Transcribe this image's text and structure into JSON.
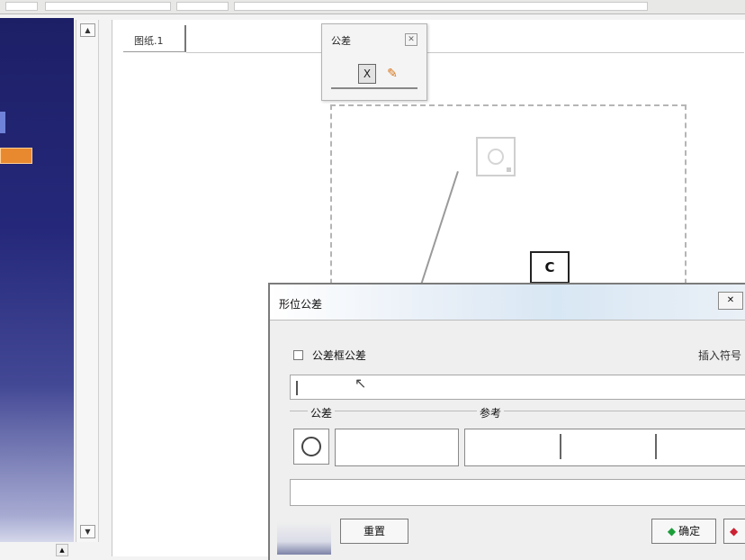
{
  "document": {
    "tab_label": "图纸.1"
  },
  "palette": {
    "title": "公差",
    "close_glyph": "✕",
    "tool1_glyph": "X",
    "tool2_glyph": "✎"
  },
  "marker": {
    "label": "C"
  },
  "dialog": {
    "title": "形位公差",
    "close_glyph": "✕",
    "checkbox_label": "公差框公差",
    "right_text": "插入符号",
    "group_tolerance_label": "公差",
    "group_reference_label": "参考",
    "button_left_label": "重置",
    "ok_label": "确定",
    "ok_icon_glyph": "◆",
    "cancel_icon_glyph": "◆"
  },
  "scroll": {
    "up_glyph": "▲",
    "down_glyph": "▼",
    "bottom_glyph": "▲"
  },
  "colors": {
    "left_panel": "#1d1f66",
    "accent_orange": "#e9892f",
    "ok_green": "#1c9e3a"
  }
}
